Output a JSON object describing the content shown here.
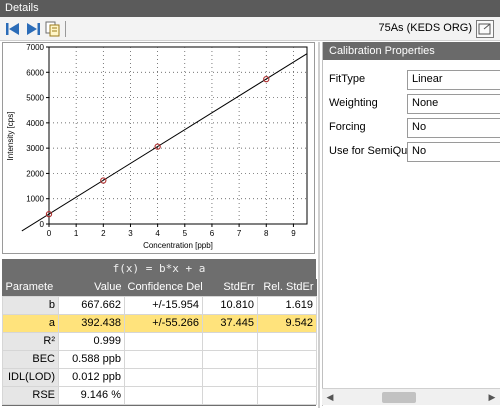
{
  "window": {
    "title": "Details"
  },
  "toolbar": {
    "analyte": "75As (KEDS ORG)",
    "icons": [
      "first-arrow-icon",
      "last-arrow-icon",
      "copy-icon",
      "export-icon"
    ]
  },
  "chart_data": {
    "type": "scatter",
    "xlabel": "Concentration [ppb]",
    "ylabel": "Intensity [cps]",
    "xlim": [
      0,
      9.5
    ],
    "ylim": [
      0,
      7000
    ],
    "x_ticks": [
      "0",
      "1",
      "2",
      "3",
      "4",
      "5",
      "6",
      "7",
      "8",
      "9"
    ],
    "y_ticks": [
      "0",
      "1000",
      "2000",
      "3000",
      "4000",
      "5000",
      "6000",
      "7000"
    ],
    "grid": true,
    "points": [
      {
        "x": 0,
        "y": 390
      },
      {
        "x": 2,
        "y": 1720
      },
      {
        "x": 4,
        "y": 3060
      },
      {
        "x": 8,
        "y": 5730
      }
    ],
    "fit": {
      "slope": 667.662,
      "intercept": 392.438,
      "x_range": [
        -1,
        9.5
      ]
    },
    "point_color": "#b03030",
    "line_color": "#000000"
  },
  "results": {
    "formula": "f(x) = b*x + a",
    "columns": [
      "Paramete",
      "Value",
      "Confidence Del",
      "StdErr",
      "Rel. StdEr"
    ],
    "rows": [
      {
        "param": "b",
        "value": "667.662",
        "conf": "+/-15.954",
        "stderr": "10.810",
        "relstderr": "1.619"
      },
      {
        "param": "a",
        "value": "392.438",
        "conf": "+/-55.266",
        "stderr": "37.445",
        "relstderr": "9.542"
      },
      {
        "param": "R²",
        "value": "0.999",
        "conf": "",
        "stderr": "",
        "relstderr": ""
      },
      {
        "param": "BEC",
        "value": "0.588 ppb",
        "conf": "",
        "stderr": "",
        "relstderr": ""
      },
      {
        "param": "IDL(LOD)",
        "value": "0.012 ppb",
        "conf": "",
        "stderr": "",
        "relstderr": ""
      },
      {
        "param": "RSE",
        "value": "9.146 %",
        "conf": "",
        "stderr": "",
        "relstderr": ""
      }
    ]
  },
  "properties": {
    "header": "Calibration Properties",
    "items": [
      {
        "label": "FitType",
        "value": "Linear"
      },
      {
        "label": "Weighting",
        "value": "None"
      },
      {
        "label": "Forcing",
        "value": "No"
      },
      {
        "label": "Use for SemiQua",
        "value": "No"
      }
    ]
  },
  "colors": {
    "selected_row": "#ffe37c",
    "header_bg": "#6e6e6e",
    "accent_blue": "#2b6cb8"
  }
}
